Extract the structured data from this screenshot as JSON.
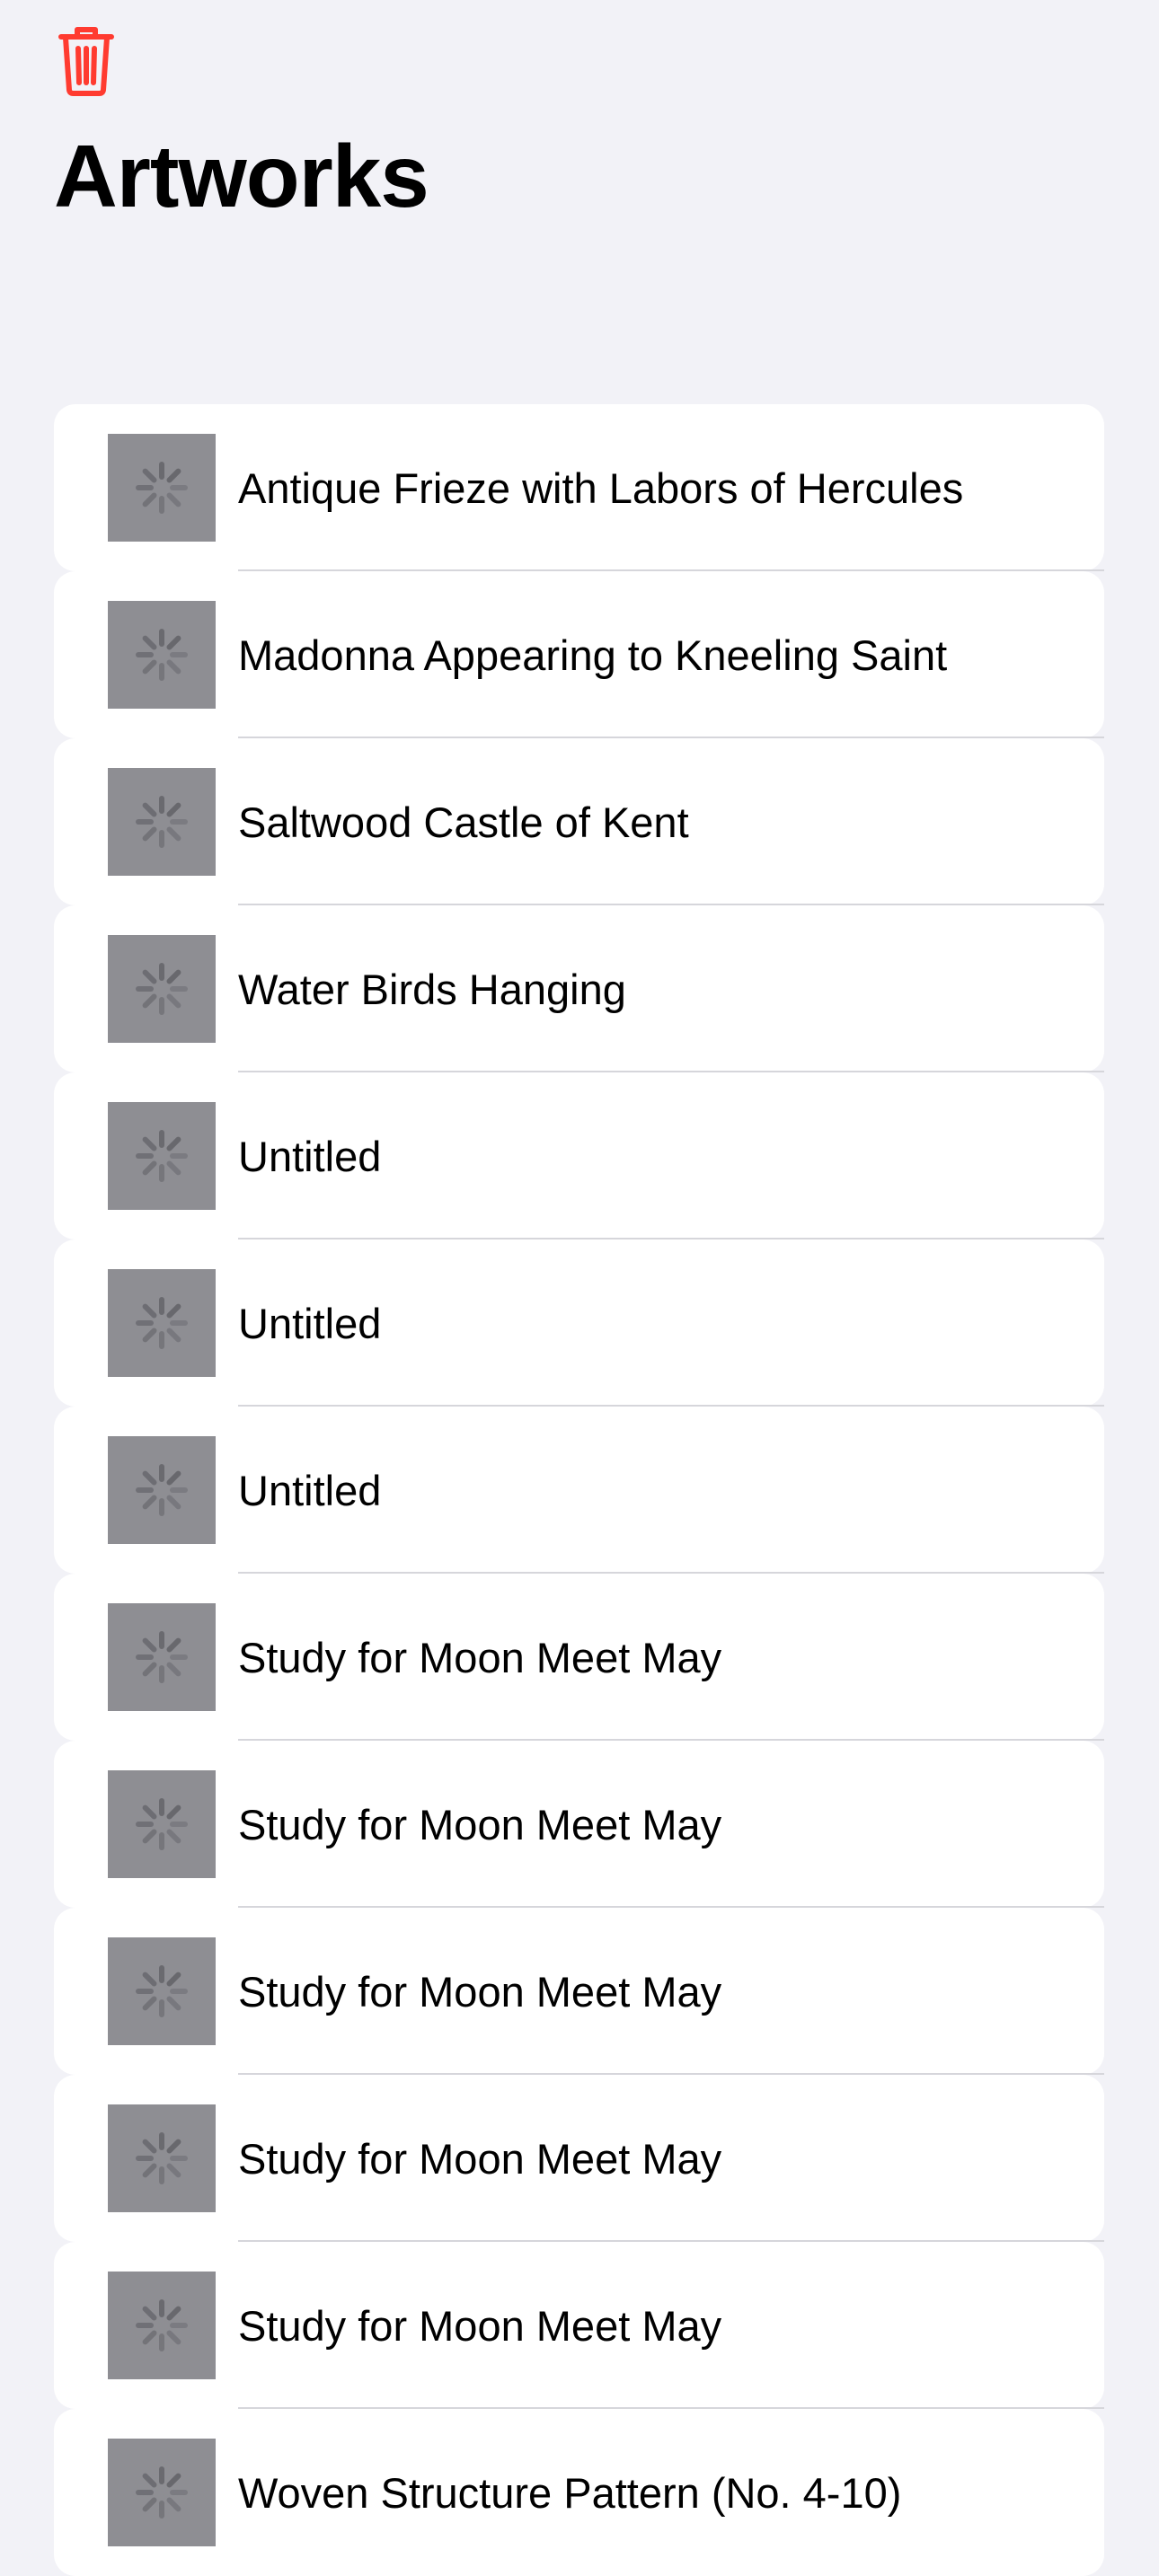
{
  "toolbar": {
    "delete_icon": "trash-icon",
    "delete_color": "#ff3b30"
  },
  "page_title": "Artworks",
  "thumbnail_state": "loading-spinner",
  "artworks": [
    {
      "title": "Antique Frieze with Labors of Hercules"
    },
    {
      "title": "Madonna Appearing to Kneeling Saint"
    },
    {
      "title": "Saltwood Castle of Kent"
    },
    {
      "title": "Water Birds Hanging"
    },
    {
      "title": "Untitled"
    },
    {
      "title": "Untitled"
    },
    {
      "title": "Untitled"
    },
    {
      "title": "Study for Moon Meet May"
    },
    {
      "title": "Study for Moon Meet May"
    },
    {
      "title": "Study for Moon Meet May"
    },
    {
      "title": "Study for Moon Meet May"
    },
    {
      "title": "Study for Moon Meet May"
    },
    {
      "title": "Woven Structure Pattern (No. 4-10)"
    }
  ]
}
